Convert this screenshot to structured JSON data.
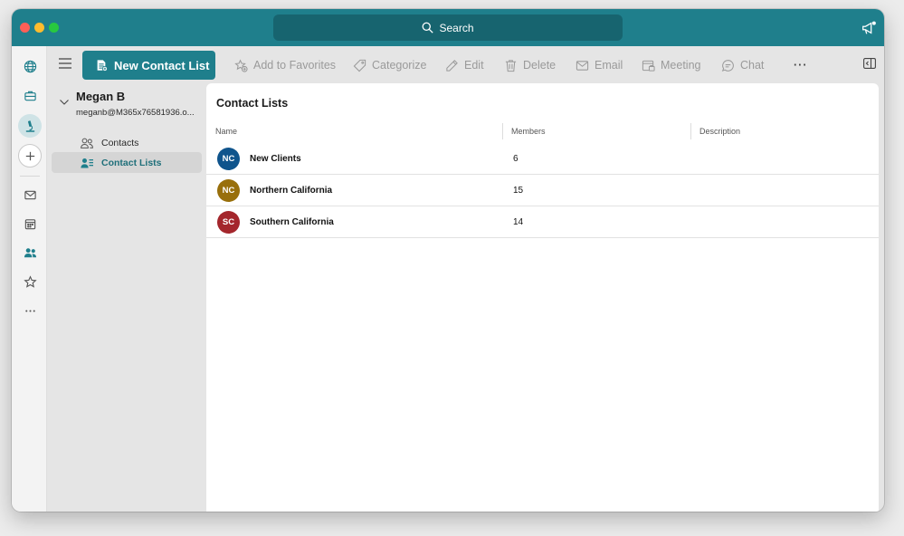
{
  "search": {
    "label": "Search"
  },
  "toolbar": {
    "new_label": "New Contact List",
    "items": [
      {
        "label": "Add to Favorites",
        "icon": "star-add-icon"
      },
      {
        "label": "Categorize",
        "icon": "tag-icon"
      },
      {
        "label": "Edit",
        "icon": "pencil-icon"
      },
      {
        "label": "Delete",
        "icon": "trash-icon"
      },
      {
        "label": "Email",
        "icon": "envelope-icon"
      },
      {
        "label": "Meeting",
        "icon": "calendar-icon"
      },
      {
        "label": "Chat",
        "icon": "chat-icon"
      }
    ],
    "more": "···"
  },
  "rail": {
    "icons": [
      "globe-icon",
      "briefcase-icon",
      "microscope-icon",
      "plus-icon",
      "mail-icon",
      "calendar-icon",
      "people-icon",
      "star-icon",
      "more-icon"
    ]
  },
  "account": {
    "name": "Megan B",
    "email": "meganb@M365x76581936.o..."
  },
  "nav": {
    "items": [
      {
        "label": "Contacts"
      },
      {
        "label": "Contact Lists"
      }
    ]
  },
  "main": {
    "title": "Contact Lists",
    "columns": [
      "Name",
      "Members",
      "Description"
    ],
    "rows": [
      {
        "initials": "NC",
        "name": "New Clients",
        "members": "6",
        "color": "#0f548c"
      },
      {
        "initials": "NC",
        "name": "Northern California",
        "members": "15",
        "color": "#986f0b"
      },
      {
        "initials": "SC",
        "name": "Southern California",
        "members": "14",
        "color": "#a4262c"
      }
    ]
  },
  "colors": {
    "accent": "#1f7f8c",
    "titlebar": "#1f7f8c",
    "search_bg": "#17646f"
  }
}
